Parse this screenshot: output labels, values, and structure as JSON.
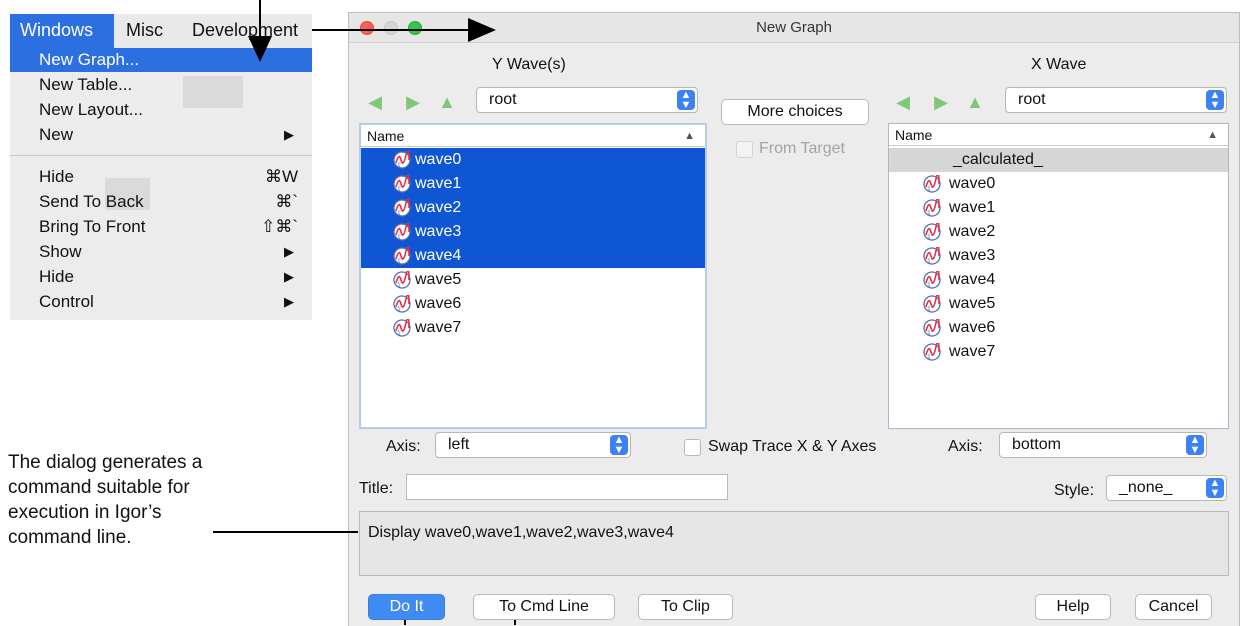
{
  "menubar": {
    "items": [
      "Windows",
      "Misc",
      "Development"
    ]
  },
  "window_menu": {
    "items": [
      {
        "label": "New Graph...",
        "shortcut": "",
        "submenu": false
      },
      {
        "label": "New Table...",
        "shortcut": "",
        "submenu": false
      },
      {
        "label": "New Layout...",
        "shortcut": "",
        "submenu": false
      },
      {
        "label": "New",
        "shortcut": "",
        "submenu": true
      },
      {
        "label": "Hide",
        "shortcut": "⌘W",
        "submenu": false
      },
      {
        "label": "Send To Back",
        "shortcut": "⌘`",
        "submenu": false
      },
      {
        "label": "Bring To Front",
        "shortcut": "⇧⌘`",
        "submenu": false
      },
      {
        "label": "Show",
        "shortcut": "",
        "submenu": true
      },
      {
        "label": "Hide",
        "shortcut": "",
        "submenu": true
      },
      {
        "label": "Control",
        "shortcut": "",
        "submenu": true
      }
    ],
    "submenu_arrow": "▶"
  },
  "dialog": {
    "title": "New Graph",
    "y_waves": {
      "label": "Y Wave(s)",
      "folder": "root",
      "list_header": "Name",
      "items": [
        "wave0",
        "wave1",
        "wave2",
        "wave3",
        "wave4",
        "wave5",
        "wave6",
        "wave7"
      ],
      "selected_count": 5
    },
    "x_wave": {
      "label": "X Wave",
      "folder": "root",
      "list_header": "Name",
      "calculated": "_calculated_",
      "items": [
        "wave0",
        "wave1",
        "wave2",
        "wave3",
        "wave4",
        "wave5",
        "wave6",
        "wave7"
      ]
    },
    "more_choices_label": "More choices",
    "from_target_label": "From Target",
    "left_axis_label": "Axis:",
    "left_axis_value": "left",
    "swap_label": "Swap Trace X & Y Axes",
    "right_axis_label": "Axis:",
    "right_axis_value": "bottom",
    "title_label": "Title:",
    "title_value": "",
    "style_label": "Style:",
    "style_value": "_none_",
    "command": "Display wave0,wave1,wave2,wave3,wave4",
    "buttons": {
      "do_it": "Do It",
      "to_cmd_line": "To Cmd Line",
      "to_clip": "To Clip",
      "help": "Help",
      "cancel": "Cancel"
    }
  },
  "annotation": {
    "lines": [
      "The dialog generates a",
      "command suitable for",
      "execution in Igor’s",
      "command line."
    ]
  },
  "colors": {
    "menu_highlight": "#2b6fe0",
    "list_selection": "#0f56d4",
    "primary_button": "#3f8bf3",
    "nav_arrow": "#7fc77a"
  }
}
